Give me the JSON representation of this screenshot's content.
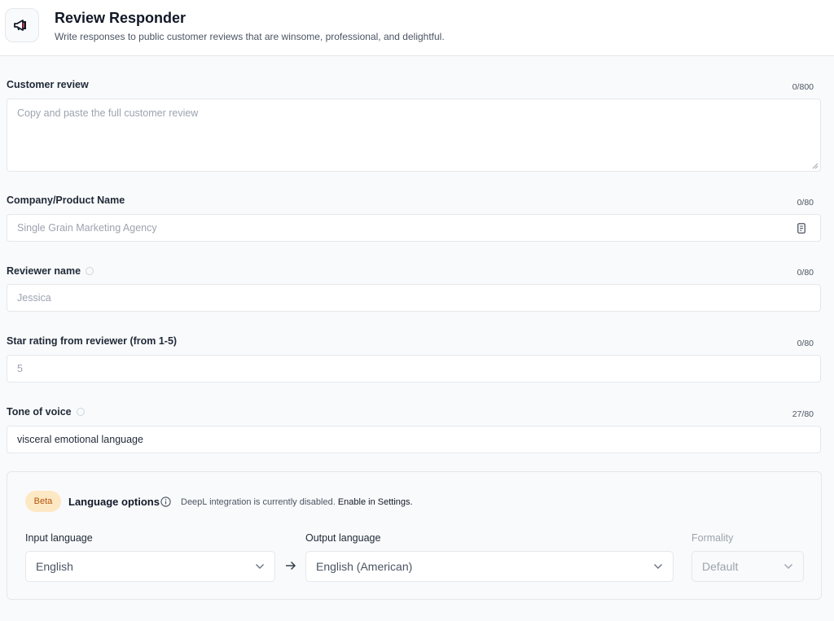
{
  "header": {
    "title": "Review Responder",
    "subtitle": "Write responses to public customer reviews that are winsome, professional, and delightful.",
    "icon": "megaphone-icon"
  },
  "fields": {
    "customer_review": {
      "label": "Customer review",
      "counter": "0/800",
      "placeholder": "Copy and paste the full customer review"
    },
    "company_name": {
      "label": "Company/Product Name",
      "counter": "0/80",
      "placeholder": "Single Grain Marketing Agency"
    },
    "reviewer_name": {
      "label": "Reviewer name",
      "counter": "0/80",
      "placeholder": "Jessica"
    },
    "star_rating": {
      "label": "Star rating from reviewer (from 1-5)",
      "counter": "0/80",
      "placeholder": "5"
    },
    "tone_of_voice": {
      "label": "Tone of voice",
      "counter": "27/80",
      "value": "visceral emotional language"
    }
  },
  "language_options": {
    "badge": "Beta",
    "title": "Language options",
    "notice": "DeepL integration is currently disabled.",
    "notice_link": "Enable in Settings.",
    "input_label": "Input language",
    "input_value": "English",
    "output_label": "Output language",
    "output_value": "English (American)",
    "formality_label": "Formality",
    "formality_value": "Default"
  },
  "colors": {
    "beta_badge_bg": "#fde8c4",
    "beta_badge_text": "#b45309",
    "border": "#e5e7eb"
  }
}
